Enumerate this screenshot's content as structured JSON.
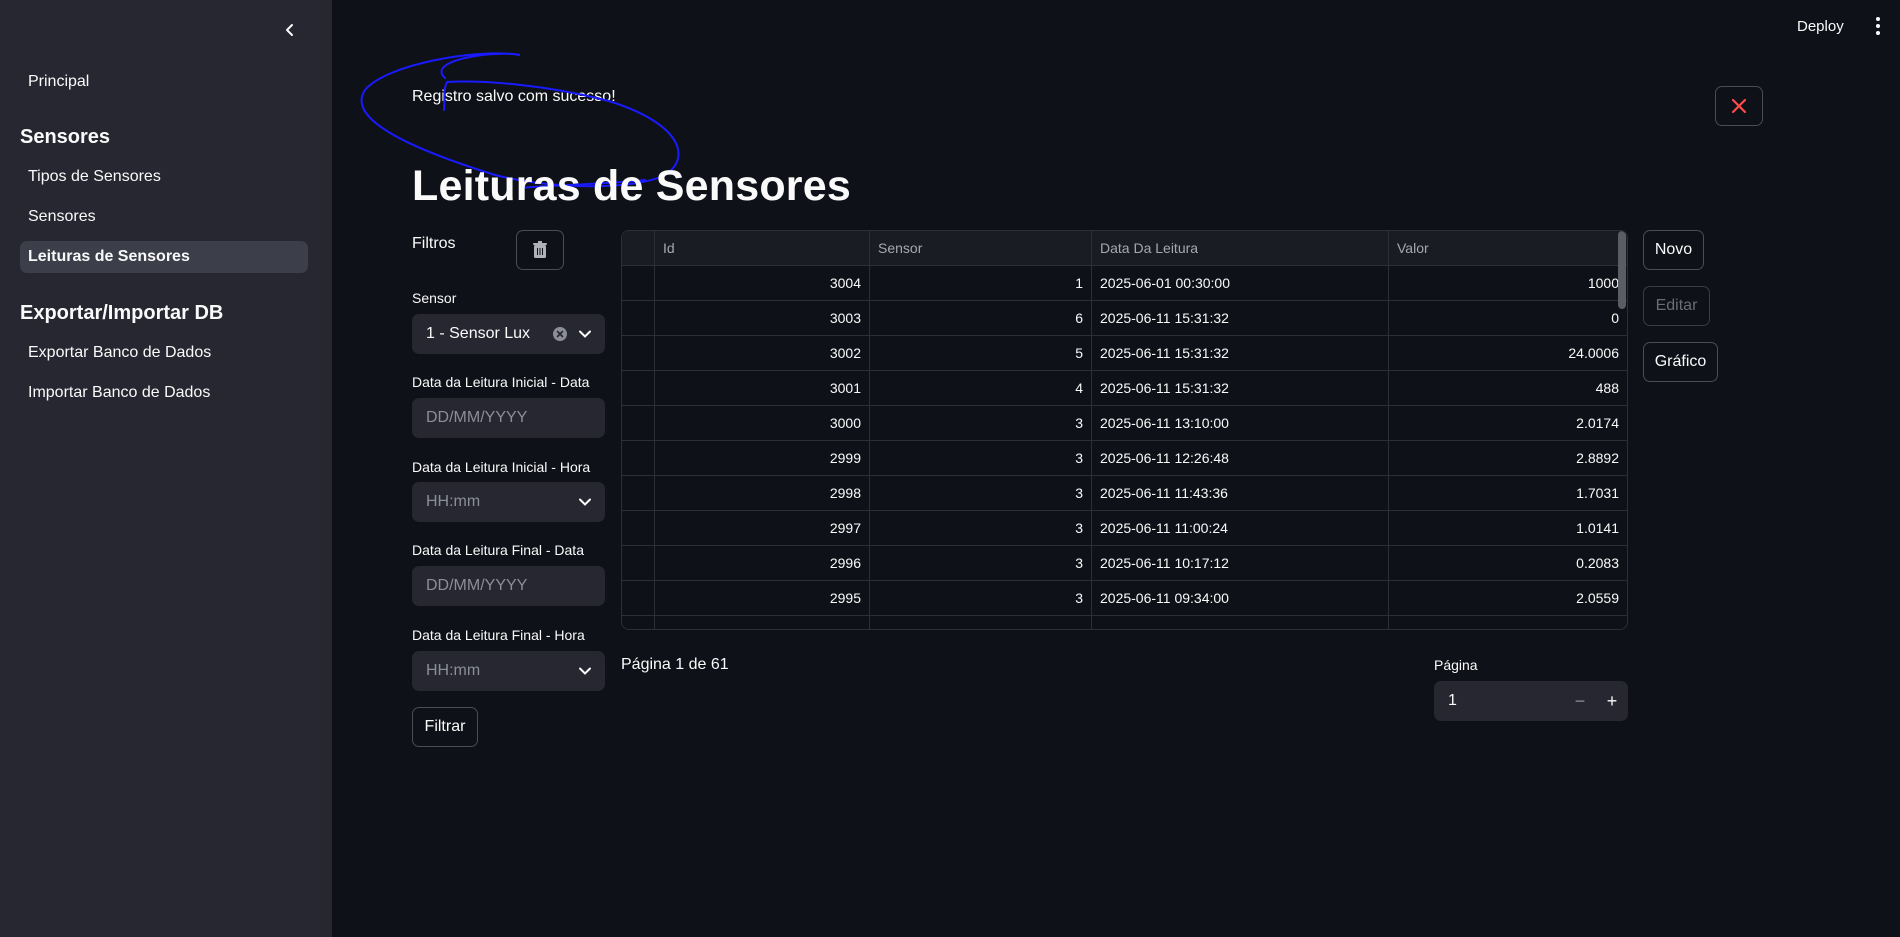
{
  "sidebar": {
    "nav_principal": "Principal",
    "section_sensores": "Sensores",
    "items_sensores": [
      "Tipos de Sensores",
      "Sensores",
      "Leituras de Sensores"
    ],
    "section_export": "Exportar/Importar DB",
    "items_export": [
      "Exportar Banco de Dados",
      "Importar Banco de Dados"
    ],
    "active": "Leituras de Sensores"
  },
  "topbar": {
    "deploy_label": "Deploy"
  },
  "alert": {
    "message": "Registro salvo com sucesso!",
    "close_color": "#ff4b4b"
  },
  "page_title": "Leituras de Sensores",
  "filters": {
    "heading": "Filtros",
    "sensor_label": "Sensor",
    "sensor_value": "1 - Sensor Lux",
    "start_date_label": "Data da Leitura Inicial - Data",
    "start_date_placeholder": "DD/MM/YYYY",
    "start_time_label": "Data da Leitura Inicial - Hora",
    "start_time_placeholder": "HH:mm",
    "end_date_label": "Data da Leitura Final - Data",
    "end_date_placeholder": "DD/MM/YYYY",
    "end_time_label": "Data da Leitura Final - Hora",
    "end_time_placeholder": "HH:mm",
    "filter_button": "Filtrar"
  },
  "table": {
    "columns": [
      "Id",
      "Sensor",
      "Data Da Leitura",
      "Valor"
    ],
    "rows": [
      [
        "3004",
        "1",
        "2025-06-01 00:30:00",
        "1000"
      ],
      [
        "3003",
        "6",
        "2025-06-11 15:31:32",
        "0"
      ],
      [
        "3002",
        "5",
        "2025-06-11 15:31:32",
        "24.0006"
      ],
      [
        "3001",
        "4",
        "2025-06-11 15:31:32",
        "488"
      ],
      [
        "3000",
        "3",
        "2025-06-11 13:10:00",
        "2.0174"
      ],
      [
        "2999",
        "3",
        "2025-06-11 12:26:48",
        "2.8892"
      ],
      [
        "2998",
        "3",
        "2025-06-11 11:43:36",
        "1.7031"
      ],
      [
        "2997",
        "3",
        "2025-06-11 11:00:24",
        "1.0141"
      ],
      [
        "2996",
        "3",
        "2025-06-11 10:17:12",
        "0.2083"
      ],
      [
        "2995",
        "3",
        "2025-06-11 09:34:00",
        "2.0559"
      ]
    ]
  },
  "actions": {
    "new": "Novo",
    "edit": "Editar",
    "chart": "Gráfico"
  },
  "pagination": {
    "info": "Página 1 de 61",
    "label": "Página",
    "value": "1",
    "minus": "−",
    "plus": "+"
  },
  "colors": {
    "background": "#0e1117",
    "sidebar": "#262730",
    "annotation": "#1a1aff",
    "trash": "#b0b2b8"
  }
}
